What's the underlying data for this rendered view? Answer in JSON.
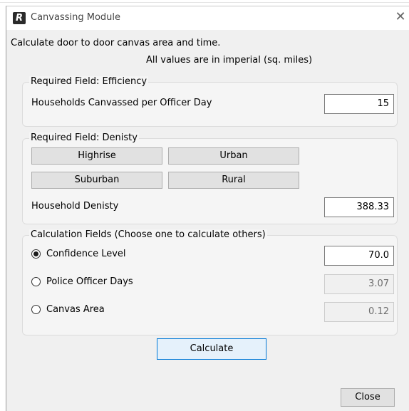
{
  "window": {
    "app_icon_letter": "R",
    "title": "Canvassing Module",
    "close_glyph": "✕"
  },
  "intro": {
    "description": "Calculate door to door canvas area and time.",
    "units_note": "All values are in imperial (sq. miles)"
  },
  "efficiency_group": {
    "title": "Required Field: Efficiency",
    "field_label": "Households Canvassed per Officer Day",
    "field_value": "15"
  },
  "density_group": {
    "title": "Required Field: Denisty",
    "buttons": {
      "highrise": "Highrise",
      "urban": "Urban",
      "suburban": "Suburban",
      "rural": "Rural"
    },
    "field_label": "Household Denisty",
    "field_value": "388.33"
  },
  "calculation_group": {
    "title": "Calculation Fields (Choose one to calculate others)",
    "options": [
      {
        "label": "Confidence Level",
        "value": "70.0",
        "selected": true
      },
      {
        "label": "Police Officer Days",
        "value": "3.07",
        "selected": false
      },
      {
        "label": "Canvas Area",
        "value": "0.12",
        "selected": false
      }
    ]
  },
  "actions": {
    "calculate_label": "Calculate",
    "close_label": "Close"
  }
}
